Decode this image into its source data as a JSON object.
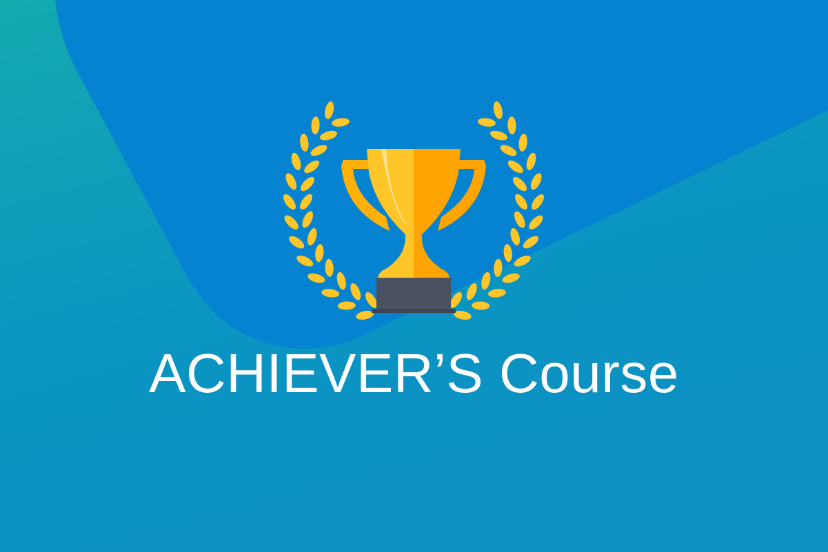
{
  "banner": {
    "title": "ACHIEVER’S Course",
    "icon": "trophy-with-laurel-wreath-icon"
  },
  "colors": {
    "teal": "#11aab0",
    "blue": "#0484d2",
    "gold_light": "#ffc629",
    "gold_dark": "#ffa400",
    "base": "#4a5160",
    "text": "#ffffff"
  }
}
